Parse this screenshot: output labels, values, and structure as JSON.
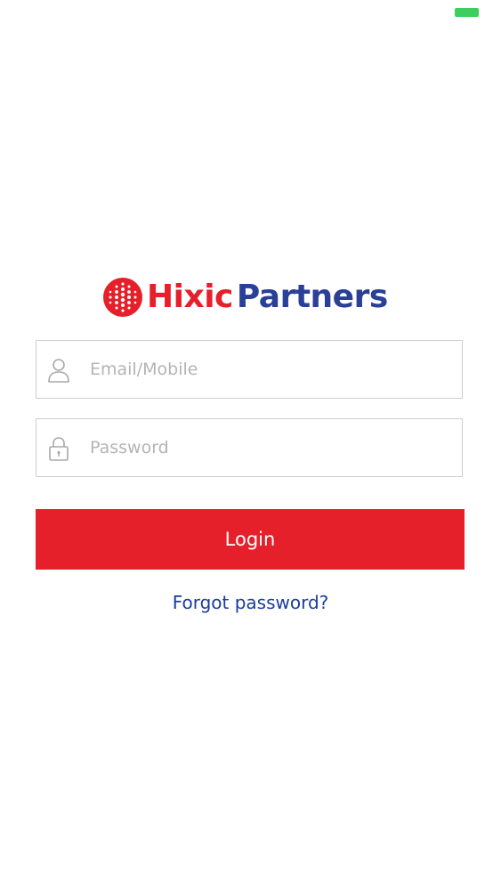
{
  "status_bar": {
    "battery_color": "#3ccf5f"
  },
  "logo": {
    "word_red": "Hixic",
    "word_blue": "Partners",
    "color_red": "#e5202b",
    "color_blue": "#2a3f98"
  },
  "form": {
    "email_placeholder": "Email/Mobile",
    "email_value": "",
    "email_icon": "user-icon",
    "password_placeholder": "Password",
    "password_value": "",
    "password_icon": "lock-icon",
    "login_label": "Login",
    "login_color": "#e5202b",
    "forgot_label": "Forgot password?",
    "forgot_color": "#1a3c9c"
  }
}
